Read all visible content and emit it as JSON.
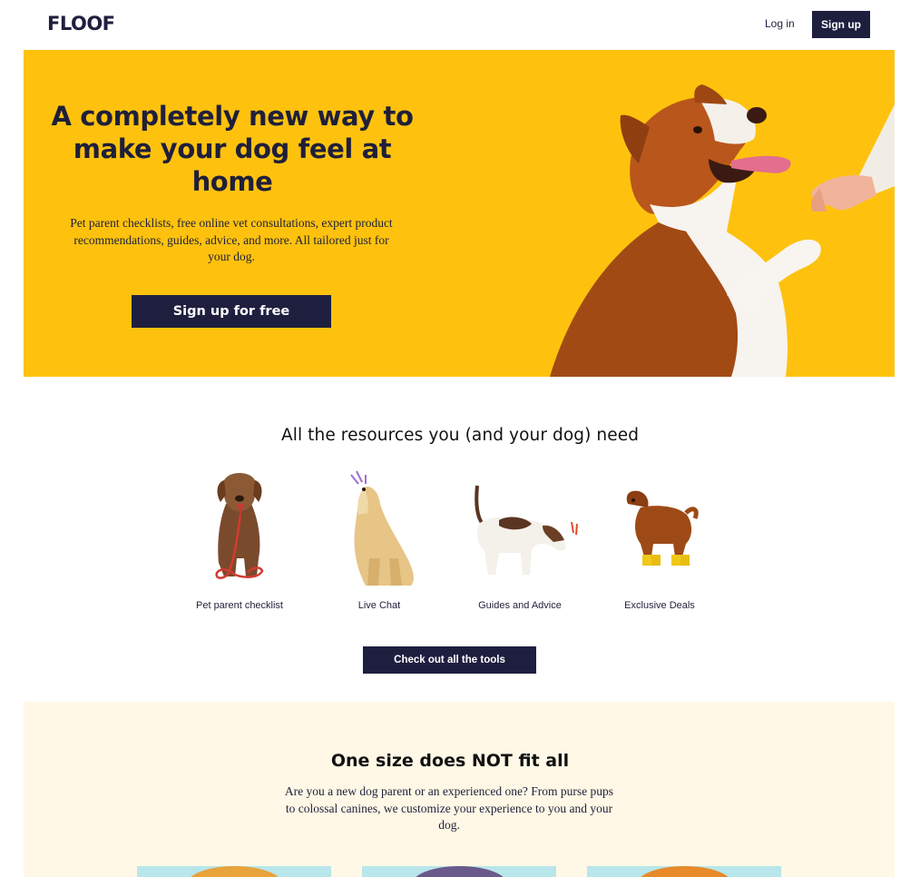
{
  "header": {
    "logo": "FLOOF",
    "login": "Log in",
    "signup": "Sign up"
  },
  "hero": {
    "title": "A completely new way to make your dog feel at home",
    "subtitle": "Pet parent checklists, free online vet consultations, expert product recommendations, guides, advice, and more. All tailored just for your dog.",
    "cta": "Sign up for free"
  },
  "resources": {
    "title": "All the resources you (and your dog) need",
    "items": [
      {
        "label": "Pet parent checklist",
        "icon": "dog-with-leash-icon"
      },
      {
        "label": "Live Chat",
        "icon": "howling-dog-icon"
      },
      {
        "label": "Guides and Advice",
        "icon": "sniffing-dog-icon"
      },
      {
        "label": "Exclusive Deals",
        "icon": "dog-in-boots-icon"
      }
    ],
    "cta": "Check out all the tools"
  },
  "onesize": {
    "title": "One size does NOT fit all",
    "subtitle": "Are you a new dog parent or an experienced one? From purse pups to colossal canines, we customize your experience to you and your dog."
  },
  "colors": {
    "navy": "#1e1f3f",
    "yellow": "#fec20e",
    "cream": "#fff8e6",
    "card_bg": "#b9e6ea"
  }
}
